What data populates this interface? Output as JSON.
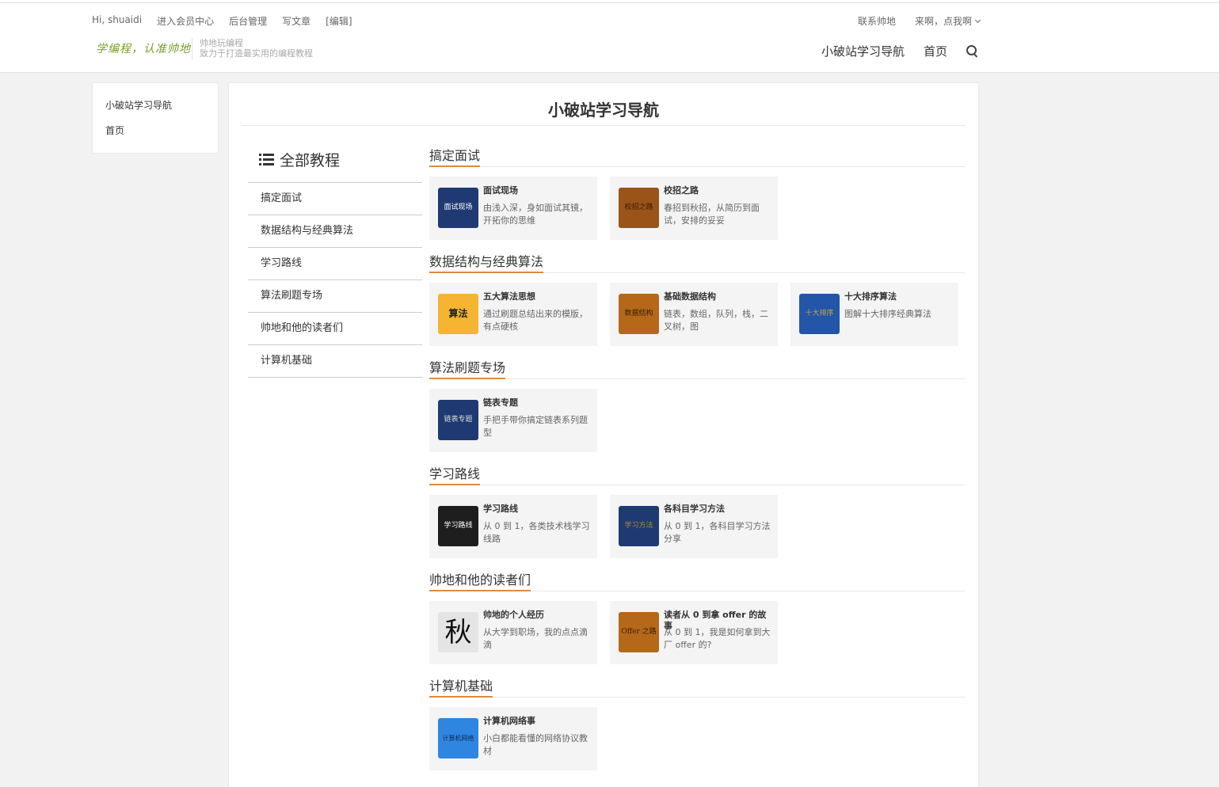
{
  "header": {
    "greeting": "Hi, shuaidi",
    "links": [
      "进入会员中心",
      "后台管理",
      "写文章",
      "[编辑]"
    ],
    "contact": "联系帅地",
    "user_menu": "来啊，点我啊",
    "logo_text": "学编程，认准帅地",
    "tagline_1": "帅地玩编程",
    "tagline_2": "致力于打造最实用的编程教程",
    "nav": [
      "小破站学习导航",
      "首页"
    ]
  },
  "sidebar": {
    "items": [
      "小破站学习导航",
      "首页"
    ]
  },
  "page": {
    "title": "小破站学习导航"
  },
  "catalog": {
    "heading": "全部教程",
    "items": [
      "搞定面试",
      "数据结构与经典算法",
      "学习路线",
      "算法刷题专场",
      "帅地和他的读者们",
      "计算机基础"
    ]
  },
  "sections": [
    {
      "title": "搞定面试",
      "cards": [
        {
          "title": "面试现场",
          "desc": "由浅入深，身如面试其镜，开拓你的思维",
          "thumb_text": "面试现场",
          "thumb_color": "#1f3a73",
          "thumb_text_color": "#ffffff"
        },
        {
          "title": "校招之路",
          "desc": "春招到秋招，从简历到面试，安排的妥妥",
          "thumb_text": "校招之路",
          "thumb_color": "#9a5418",
          "thumb_text_color": "#3a1e05"
        }
      ]
    },
    {
      "title": "数据结构与经典算法",
      "cards": [
        {
          "title": "五大算法思想",
          "desc": "通过刷题总结出来的模版，有点硬核",
          "thumb_text": "算法",
          "thumb_color": "#f5b533",
          "thumb_text_color": "#222222"
        },
        {
          "title": "基础数据结构",
          "desc": "链表，数组，队列，栈，二叉树，图",
          "thumb_text": "数据结构",
          "thumb_color": "#b5681a",
          "thumb_text_color": "#3a1e05"
        },
        {
          "title": "十大排序算法",
          "desc": "图解十大排序经典算法",
          "thumb_text": "十大排序",
          "thumb_color": "#2356a8",
          "thumb_text_color": "#c9a24a"
        }
      ]
    },
    {
      "title": "算法刷题专场",
      "cards": [
        {
          "title": "链表专题",
          "desc": "手把手带你搞定链表系列题型",
          "thumb_text": "链表专题",
          "thumb_color": "#1f3a73",
          "thumb_text_color": "#dddddd"
        }
      ]
    },
    {
      "title": "学习路线",
      "cards": [
        {
          "title": "学习路线",
          "desc": "从 0 到 1，各类技术栈学习线路",
          "thumb_text": "学习路线",
          "thumb_color": "#1e1e1e",
          "thumb_text_color": "#ffffff"
        },
        {
          "title": "各科目学习方法",
          "desc": "从 0 到 1，各科目学习方法分享",
          "thumb_text": "学习方法",
          "thumb_color": "#1f3a73",
          "thumb_text_color": "#b08a3a"
        }
      ]
    },
    {
      "title": "帅地和他的读者们",
      "cards": [
        {
          "title": "帅地的个人经历",
          "desc": "从大学到职场，我的点点滴滴",
          "thumb_text": "秋",
          "thumb_color": "#e4e4e4",
          "thumb_text_color": "#111111"
        },
        {
          "title": "读者从 0 到拿 offer 的故事",
          "desc": "从 0 到 1，我是如何拿到大厂 offer 的?",
          "thumb_text": "Offer 之路",
          "thumb_color": "#b5681a",
          "thumb_text_color": "#3a1e05"
        }
      ]
    },
    {
      "title": "计算机基础",
      "cards": [
        {
          "title": "计算机网络事",
          "desc": "小白都能看懂的网络协议教材",
          "thumb_text": "计算机网络",
          "thumb_color": "#2f86e0",
          "thumb_text_color": "#0d2a55"
        }
      ]
    }
  ]
}
